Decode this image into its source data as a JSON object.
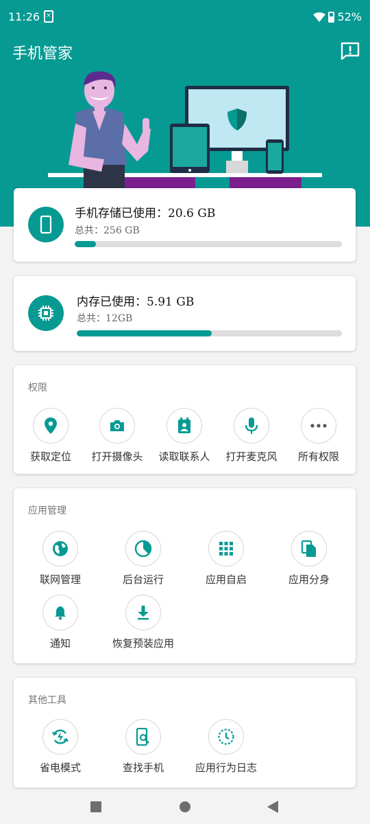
{
  "status_bar": {
    "time": "11:26",
    "battery": "52%"
  },
  "app": {
    "title": "手机管家"
  },
  "storage": {
    "title": "手机存储已使用：20.6 GB",
    "total": "总共：256 GB",
    "used_fraction": 0.08
  },
  "memory": {
    "title": "内存已使用：5.91 GB",
    "total": "总共：12GB",
    "used_fraction": 0.51
  },
  "permissions": {
    "title": "权限",
    "items": [
      {
        "label": "获取定位",
        "icon": "location-pin-icon"
      },
      {
        "label": "打开摄像头",
        "icon": "camera-icon"
      },
      {
        "label": "读取联系人",
        "icon": "contacts-icon"
      },
      {
        "label": "打开麦克风",
        "icon": "microphone-icon"
      },
      {
        "label": "所有权限",
        "icon": "more-icon"
      }
    ]
  },
  "app_management": {
    "title": "应用管理",
    "items": [
      {
        "label": "联网管理",
        "icon": "globe-icon"
      },
      {
        "label": "后台运行",
        "icon": "background-run-icon"
      },
      {
        "label": "应用自启",
        "icon": "grid-icon"
      },
      {
        "label": "应用分身",
        "icon": "clone-icon"
      },
      {
        "label": "通知",
        "icon": "bell-icon"
      },
      {
        "label": "恢复预装应用",
        "icon": "download-icon"
      }
    ]
  },
  "other_tools": {
    "title": "其他工具",
    "items": [
      {
        "label": "省电模式",
        "icon": "power-saving-icon"
      },
      {
        "label": "查找手机",
        "icon": "find-phone-icon"
      },
      {
        "label": "应用行为日志",
        "icon": "behavior-log-icon"
      }
    ]
  },
  "colors": {
    "accent": "#079a93",
    "background": "#f3f3f3",
    "card": "#ffffff"
  }
}
